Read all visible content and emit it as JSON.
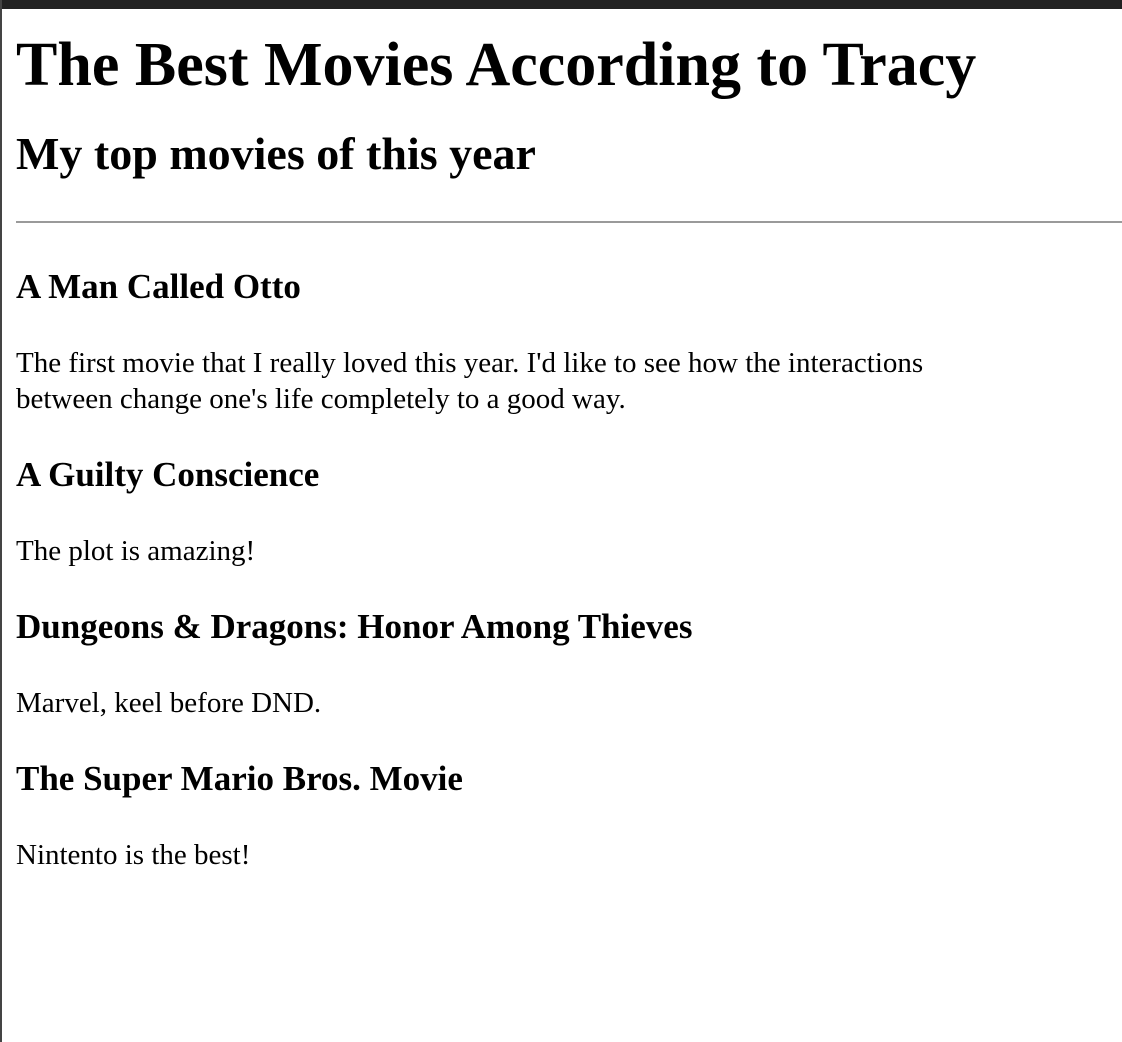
{
  "page": {
    "title": "The Best Movies According to Tracy",
    "subtitle": "My top movies of this year"
  },
  "movies": [
    {
      "title": "A Man Called Otto",
      "review": "The first movie that I really loved this year. I'd like to see how the interactions between change one's life completely to a good way."
    },
    {
      "title": "A Guilty Conscience",
      "review": "The plot is amazing!"
    },
    {
      "title": "Dungeons & Dragons: Honor Among Thieves",
      "review": "Marvel, keel before DND."
    },
    {
      "title": "The Super Mario Bros. Movie",
      "review": "Nintento is the best!"
    }
  ]
}
